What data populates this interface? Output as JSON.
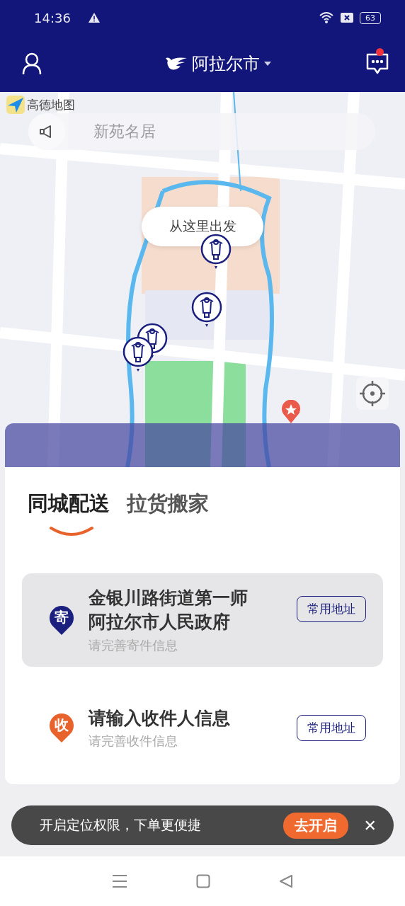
{
  "status_bar": {
    "time": "14:36",
    "battery": "63"
  },
  "header": {
    "city": "阿拉尔市",
    "unread": true
  },
  "map": {
    "logo": "高德地图",
    "notice": "新苑名居",
    "callout": "从这里出发"
  },
  "tabs": [
    {
      "label": "同城配送",
      "selected": true
    },
    {
      "label": "拉货搬家",
      "selected": false
    }
  ],
  "addresses": [
    {
      "kind": "sender",
      "badge": "寄",
      "color": "#1b1f7e",
      "title": "金银川路街道第一师阿拉尔市人民政府",
      "hint": "请完善寄件信息",
      "button": "常用地址"
    },
    {
      "kind": "receiver",
      "badge": "收",
      "color": "#e8622c",
      "title": "请输入收件人信息",
      "hint": "请完善收件信息",
      "button": "常用地址"
    }
  ],
  "toast": {
    "text": "开启定位权限，下单更便捷",
    "action": "去开启",
    "close": "✕"
  }
}
